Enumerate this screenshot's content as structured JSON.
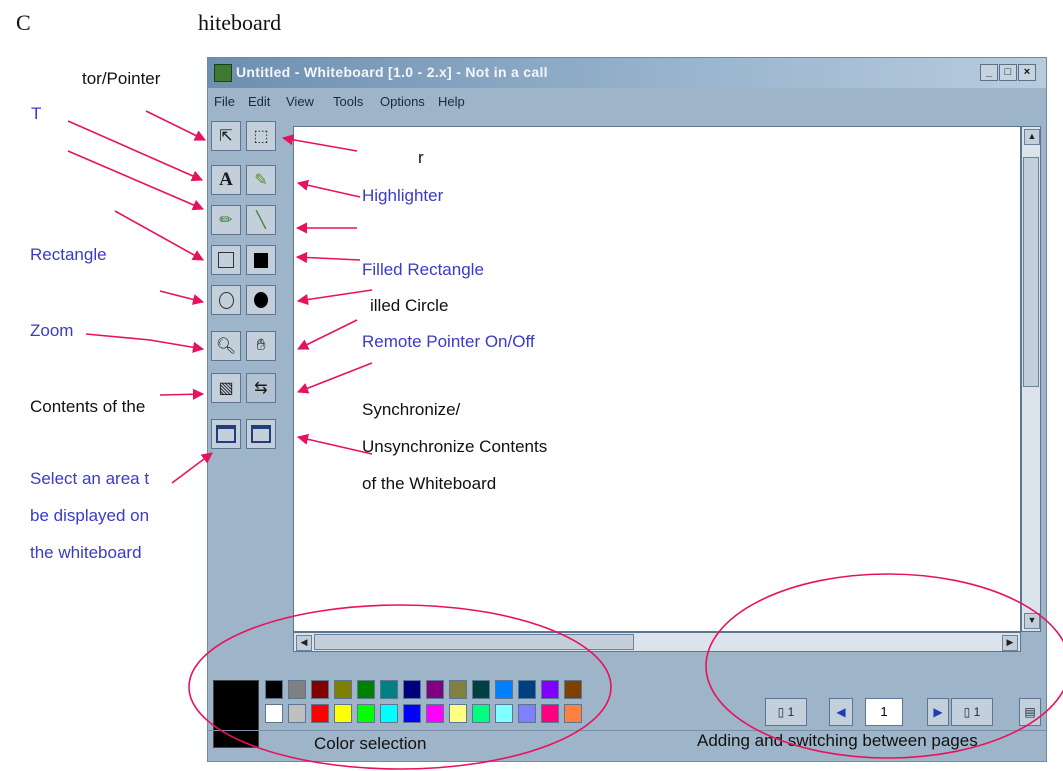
{
  "heading": {
    "left": "C",
    "right": "hiteboard"
  },
  "window": {
    "title": "Untitled - Whiteboard [1.0 - 2.x] - Not in a call",
    "buttons": [
      "_",
      "□",
      "×"
    ],
    "menu": [
      "File",
      "Edit",
      "View",
      "Tools",
      "Options",
      "Help"
    ]
  },
  "tools": [
    [
      "pointer-tool",
      "text-tool",
      "pen-tool",
      "unfilled-rectangle-tool",
      "unfilled-ellipse-tool",
      "zoom-tool",
      "lock-contents-tool",
      "select-area-tool"
    ],
    [
      "select-area-tool",
      "highlighter-tool",
      "line-tool",
      "filled-rectangle-tool",
      "filled-ellipse-tool",
      "remote-pointer-tool",
      "sync-tool",
      "select-window-tool"
    ]
  ],
  "labels": {
    "selector_pointer": "tor/Pointer",
    "text": "T",
    "rectangle": "Rectangle",
    "zoom": "Zoom",
    "lock_contents": "Contents of the",
    "select_area": [
      "Select an area t",
      "be displayed on",
      "the whiteboard"
    ],
    "r_fragment": "r",
    "highlighter": "Highlighter",
    "filled_rectangle": "Filled Rectangle",
    "filled_circle": "illed Circle",
    "remote_pointer": "Remote Pointer On/Off",
    "sync": [
      "Synchronize/",
      "Unsynchronize Contents",
      "of the Whiteboard"
    ],
    "color_selection": "Color selection",
    "pages": "Adding and switching between pages"
  },
  "palette": {
    "current": "#000000",
    "top_row": [
      "#000000",
      "#808080",
      "#800000",
      "#808000",
      "#008000",
      "#008080",
      "#000080",
      "#800080",
      "#808040",
      "#004040",
      "#0080ff",
      "#004080",
      "#8000ff",
      "#804000"
    ],
    "bottom_row": [
      "#ffffff",
      "#c0c0c0",
      "#ff0000",
      "#ffff00",
      "#00ff00",
      "#00ffff",
      "#0000ff",
      "#ff00ff",
      "#ffff80",
      "#00ff80",
      "#80ffff",
      "#8080ff",
      "#ff0080",
      "#ff8040"
    ]
  },
  "pagenav": {
    "page_count_left": "1",
    "current_page": "1",
    "page_count_right": "1"
  },
  "colors": {
    "annotation_arrow": "#e8115e",
    "annotation_blue": "#3a3acc",
    "window_bg": "#9eb4c8"
  }
}
